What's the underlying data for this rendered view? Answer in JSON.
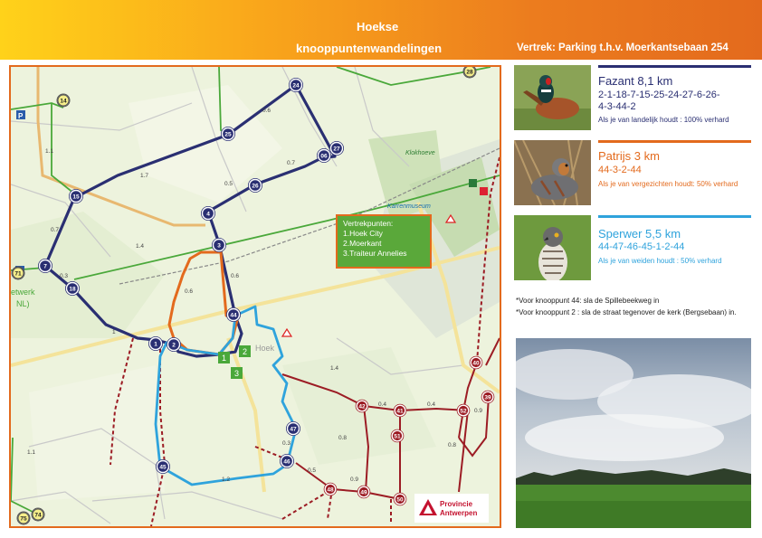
{
  "header": {
    "title_line1": "Hoekse",
    "title_line2": "knooppuntenwandelingen",
    "start": "Vertrek: Parking t.h.v. Moerkantsebaan 254"
  },
  "map": {
    "legend": {
      "title": "Vertrekpunten:",
      "items": [
        "1.Hoek City",
        "2.Moerkant",
        "3.Traiteur Annelies"
      ]
    },
    "places": {
      "klokhoeve": "Klokhoeve",
      "karrenmuseum": "Karrenmuseum",
      "hoek": "Hoek",
      "netwerk_a": "etwerk",
      "netwerk_b": "NL)"
    },
    "start_markers": [
      "1",
      "2",
      "3"
    ],
    "nodes": [
      "1",
      "2",
      "3",
      "4",
      "7",
      "14",
      "15",
      "18",
      "24",
      "25",
      "26",
      "27",
      "28",
      "39",
      "40",
      "41",
      "42",
      "44",
      "45",
      "46",
      "47",
      "48",
      "49",
      "50",
      "51",
      "52",
      "71",
      "74",
      "75",
      "06"
    ],
    "distances": [
      "0.6",
      "1.7",
      "0.7",
      "1.1",
      "0.7",
      "0.3",
      "1.4",
      "1",
      "0.5",
      "0.6",
      "0.6",
      "1.2",
      "0.3",
      "1.4",
      "0.4",
      "0.4",
      "0.5",
      "0.9",
      "0.8",
      "0.8",
      "0.8",
      "0.9",
      "1.1"
    ],
    "colors": {
      "fazant": "#2a2f72",
      "patrijs": "#e36a1d",
      "sperwer": "#2fa3dc",
      "node_ring": "#2a2f72",
      "red_network": "#9c1c24"
    }
  },
  "routes": [
    {
      "name": "Fazant 8,1 km",
      "sequence_line1": "2-1-18-7-15-25-24-27-6-26-",
      "sequence_line2": "4-3-44-2",
      "note": "Als je van landelijk houdt : 100% verhard",
      "color": "#2a2f72",
      "photo": "fazant-photo"
    },
    {
      "name": "Patrijs 3 km",
      "sequence_line1": "44-3-2-44",
      "note": "Als je van vergezichten houdt: 50% verhard",
      "color": "#e36a1d",
      "photo": "patrijs-photo"
    },
    {
      "name": "Sperwer 5,5 km",
      "sequence_line1": "44-47-46-45-1-2-44",
      "note": "Als je van weiden houdt : 50% verhard",
      "color": "#2fa3dc",
      "photo": "sperwer-photo"
    }
  ],
  "footnotes": [
    "*Voor knooppunt 44: sla de Spillebeekweg in",
    "*Voor knooppunt 2 : sla de straat tegenover de kerk (Bergsebaan) in."
  ],
  "logo": {
    "line1": "Provincie",
    "line2": "Antwerpen"
  }
}
